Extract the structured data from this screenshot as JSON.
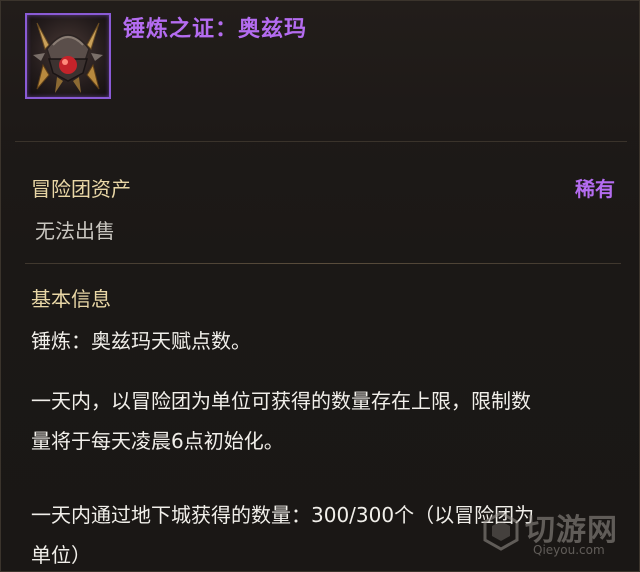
{
  "item": {
    "name": "锤炼之证：奥兹玛",
    "icon": "ozma-crest-icon",
    "rarity": "稀有",
    "rarity_color": "#b46cf0"
  },
  "properties": {
    "asset_label": "冒险团资产",
    "sell_status": "无法出售"
  },
  "info": {
    "section_title": "基本信息",
    "lines": [
      "锤炼：奥兹玛天赋点数。",
      "一天内，以冒险团为单位可获得的数量存在上限，限制数",
      "量将于每天凌晨6点初始化。",
      "一天内通过地下城获得的数量：300/300个（以冒险团为",
      "单位）"
    ]
  },
  "watermark": {
    "name": "切游网",
    "url": "Qieyou.com"
  },
  "colors": {
    "label_gold": "#e9d7a6",
    "text_white": "#f1efea",
    "muted_text": "#c9c6c0"
  }
}
